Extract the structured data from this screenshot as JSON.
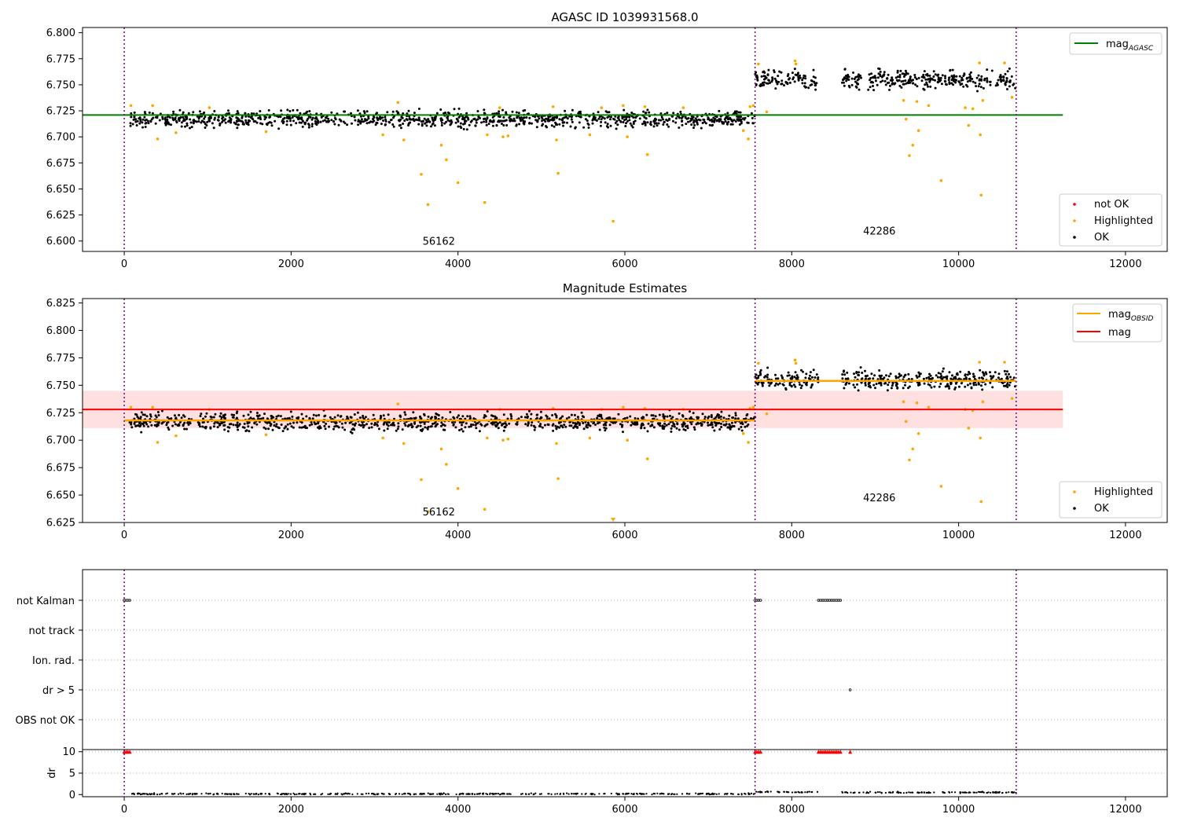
{
  "chart_data": [
    {
      "id": "agasc",
      "type": "scatter",
      "title": "AGASC ID 1039931568.0",
      "xlim": [
        -500,
        12500
      ],
      "ylim": [
        6.59,
        6.805
      ],
      "xticks": [
        0,
        2000,
        4000,
        6000,
        8000,
        10000,
        12000
      ],
      "xtick_labels": [
        "0",
        "2000",
        "4000",
        "6000",
        "8000",
        "10000",
        "12000"
      ],
      "yticks": [
        6.6,
        6.625,
        6.65,
        6.675,
        6.7,
        6.725,
        6.75,
        6.775,
        6.8
      ],
      "ytick_labels": [
        "6.600",
        "6.625",
        "6.650",
        "6.675",
        "6.700",
        "6.725",
        "6.750",
        "6.775",
        "6.800"
      ],
      "obs_boundaries": [
        0,
        7560,
        10690
      ],
      "obs_labels": [
        {
          "text": "56162",
          "x": 3770,
          "y": 6.6
        },
        {
          "text": "42286",
          "x": 9050,
          "y": 6.61
        }
      ],
      "series": [
        {
          "name": "OK",
          "color": "#000000",
          "segments": [
            {
              "x0": 60,
              "x1": 7560,
              "center": 6.717,
              "spread": 0.0085,
              "gap": null
            },
            {
              "x0": 7560,
              "x1": 10690,
              "center": 6.755,
              "spread": 0.0095,
              "gap": [
                8320,
                8600
              ]
            }
          ]
        },
        {
          "name": "Highlighted",
          "color": "#ffa500",
          "points": [
            [
              80,
              6.73
            ],
            [
              340,
              6.73
            ],
            [
              400,
              6.698
            ],
            [
              620,
              6.704
            ],
            [
              1020,
              6.728
            ],
            [
              1700,
              6.705
            ],
            [
              3100,
              6.702
            ],
            [
              3280,
              6.733
            ],
            [
              3350,
              6.697
            ],
            [
              3560,
              6.664
            ],
            [
              3640,
              6.635
            ],
            [
              3800,
              6.692
            ],
            [
              3860,
              6.678
            ],
            [
              4000,
              6.656
            ],
            [
              4320,
              6.637
            ],
            [
              4350,
              6.702
            ],
            [
              4500,
              6.728
            ],
            [
              4540,
              6.7
            ],
            [
              4600,
              6.701
            ],
            [
              5140,
              6.729
            ],
            [
              5180,
              6.697
            ],
            [
              5200,
              6.665
            ],
            [
              5580,
              6.702
            ],
            [
              5720,
              6.728
            ],
            [
              5860,
              6.619
            ],
            [
              5980,
              6.73
            ],
            [
              6030,
              6.7
            ],
            [
              6240,
              6.729
            ],
            [
              6270,
              6.683
            ],
            [
              6700,
              6.728
            ],
            [
              7420,
              6.706
            ],
            [
              7480,
              6.698
            ],
            [
              7500,
              6.729
            ],
            [
              7540,
              6.73
            ],
            [
              7600,
              6.77
            ],
            [
              7700,
              6.724
            ],
            [
              8040,
              6.773
            ],
            [
              8050,
              6.77
            ],
            [
              9340,
              6.735
            ],
            [
              9370,
              6.717
            ],
            [
              9410,
              6.682
            ],
            [
              9450,
              6.692
            ],
            [
              9500,
              6.734
            ],
            [
              9520,
              6.706
            ],
            [
              9640,
              6.73
            ],
            [
              9790,
              6.658
            ],
            [
              10080,
              6.728
            ],
            [
              10120,
              6.711
            ],
            [
              10170,
              6.727
            ],
            [
              10250,
              6.771
            ],
            [
              10260,
              6.702
            ],
            [
              10270,
              6.644
            ],
            [
              10290,
              6.735
            ],
            [
              10550,
              6.771
            ],
            [
              10640,
              6.738
            ]
          ]
        },
        {
          "name": "mag_AGASC",
          "color": "#008000",
          "type": "hline",
          "y": 6.721
        }
      ],
      "legend_top": {
        "placement": "upper right",
        "entries": [
          {
            "label": "mag",
            "sub": "AGASC",
            "color": "#008000"
          }
        ]
      },
      "legend_bottom": {
        "placement": "lower right",
        "entries": [
          {
            "label": "not OK",
            "color": "#ff0000"
          },
          {
            "label": "Highlighted",
            "color": "#ffa500"
          },
          {
            "label": "OK",
            "color": "#000000"
          }
        ]
      }
    },
    {
      "id": "estimates",
      "type": "scatter",
      "title": "Magnitude Estimates",
      "xlim": [
        -500,
        12500
      ],
      "ylim": [
        6.625,
        6.829
      ],
      "xticks": [
        0,
        2000,
        4000,
        6000,
        8000,
        10000,
        12000
      ],
      "xtick_labels": [
        "0",
        "2000",
        "4000",
        "6000",
        "8000",
        "10000",
        "12000"
      ],
      "yticks": [
        6.625,
        6.65,
        6.675,
        6.7,
        6.725,
        6.75,
        6.775,
        6.8,
        6.825
      ],
      "ytick_labels": [
        "6.625",
        "6.650",
        "6.675",
        "6.700",
        "6.725",
        "6.750",
        "6.775",
        "6.800",
        "6.825"
      ],
      "obs_boundaries": [
        0,
        7560,
        10690
      ],
      "obs_labels": [
        {
          "text": "56162",
          "x": 3770,
          "y": 6.635
        },
        {
          "text": "42286",
          "x": 9050,
          "y": 6.648
        }
      ],
      "mag_band": {
        "center": 6.728,
        "low": 6.711,
        "high": 6.745,
        "color": "#ff0000"
      },
      "obsid_means": [
        {
          "x0": 0,
          "x1": 7560,
          "y": 6.718
        },
        {
          "x0": 7560,
          "x1": 10690,
          "y": 6.754
        }
      ],
      "legend_top": {
        "placement": "upper right",
        "entries": [
          {
            "label": "mag",
            "sub": "OBSID",
            "color": "#ffa500"
          },
          {
            "label": "mag",
            "sub": "",
            "color": "#ff0000"
          }
        ]
      },
      "legend_bottom": {
        "placement": "lower right",
        "entries": [
          {
            "label": "Highlighted",
            "color": "#ffa500"
          },
          {
            "label": "OK",
            "color": "#000000"
          }
        ]
      }
    },
    {
      "id": "flags",
      "type": "scatter",
      "xlim": [
        -500,
        12500
      ],
      "categories": [
        "not Kalman",
        "not track",
        "Ion. rad.",
        "dr > 5",
        "OBS not OK"
      ],
      "flag_points": [
        {
          "row": "not Kalman",
          "ranges": [
            [
              0,
              80
            ],
            [
              7560,
              7640
            ],
            [
              8320,
              8600
            ]
          ]
        },
        {
          "row": "dr > 5",
          "ranges": [
            [
              8700,
              8700
            ]
          ]
        }
      ]
    },
    {
      "id": "dr",
      "type": "scatter",
      "ylabel": "dr",
      "xlim": [
        -500,
        12500
      ],
      "ylim": [
        -0.5,
        10.5
      ],
      "yticks": [
        0,
        5,
        10
      ],
      "ytick_labels": [
        "0",
        "5",
        "10"
      ],
      "xticks": [
        0,
        2000,
        4000,
        6000,
        8000,
        10000,
        12000
      ],
      "xtick_labels": [
        "0",
        "2000",
        "4000",
        "6000",
        "8000",
        "10000",
        "12000"
      ],
      "clipped_ranges": [
        [
          0,
          80
        ],
        [
          7560,
          7640
        ],
        [
          8320,
          8600
        ],
        [
          8700,
          8700
        ]
      ],
      "baseline_segments": [
        {
          "x0": 60,
          "x1": 7560,
          "center": 0.15
        },
        {
          "x0": 7560,
          "x1": 8320,
          "center": 0.6
        },
        {
          "x0": 8600,
          "x1": 10690,
          "center": 0.5
        }
      ]
    }
  ]
}
